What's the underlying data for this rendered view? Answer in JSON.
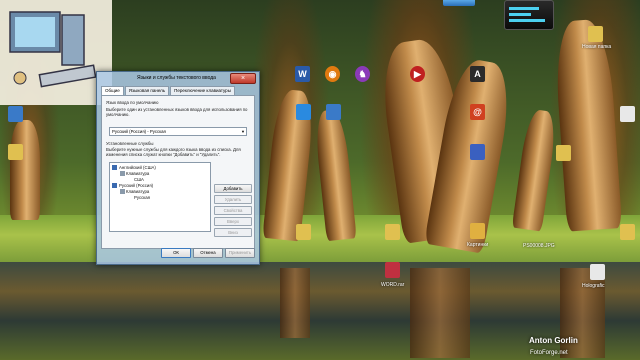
{
  "dialog": {
    "title": "Языки и службы текстового ввода",
    "tabs": [
      "Общие",
      "Языковая панель",
      "Переключение клавиатуры"
    ],
    "default_lang_heading": "Язык ввода по умолчанию",
    "default_lang_desc": "Выберите один из установленных языков ввода для использования по умолчанию.",
    "default_lang_value": "Русский (Россия) - Русская",
    "installed_heading": "Установленные службы",
    "installed_desc": "Выберите нужные службы для каждого языка ввода из списка. Для изменения списка служат кнопки \"Добавить\" и \"Удалить\".",
    "tree": {
      "lang1": "Английский (США)",
      "lang1_group": "Клавиатура",
      "lang1_item": "США",
      "lang2": "Русский (Россия)",
      "lang2_group": "Клавиатура",
      "lang2_item": "Русская"
    },
    "side_buttons": {
      "add": "Добавить",
      "remove": "Удалить",
      "properties": "Свойства",
      "up": "Вверх",
      "down": "Вниз"
    },
    "footer": {
      "ok": "ОК",
      "cancel": "Отмена",
      "apply": "Применить"
    },
    "close_symbol": "×"
  },
  "desktop_icons": [
    {
      "name": "Office",
      "symbol": "W"
    },
    {
      "name": "Media",
      "symbol": "◉"
    },
    {
      "name": "Game",
      "symbol": "♞"
    },
    {
      "name": "Reader",
      "symbol": "A"
    },
    {
      "name": "Video",
      "symbol": "▶"
    },
    {
      "name": "Mail",
      "symbol": "@"
    }
  ],
  "icon_labels": {
    "ps_file": "PS00008.JPG",
    "word_file": "WORD.rar",
    "holografic": "Holografic",
    "kartinki": "Картинки",
    "new_folder": "Новая папка"
  },
  "watermark": {
    "author": "Anton Gorlin",
    "site": "FotoForge.net"
  },
  "colors": {
    "accent": "#4a6a8a",
    "dialog_bg": "#aac8e6"
  }
}
